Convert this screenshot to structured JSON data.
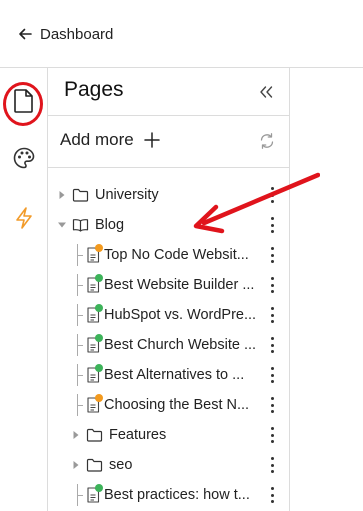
{
  "topbar": {
    "back_label": "Dashboard"
  },
  "panel": {
    "title": "Pages",
    "add_more_label": "Add more"
  },
  "colors": {
    "published": "#3db35a",
    "draft": "#f39a1e",
    "annotation": "#e0141c",
    "accent_icon": "#f29b2a"
  },
  "tree": [
    {
      "type": "folder",
      "label": "University",
      "expanded": false
    },
    {
      "type": "book",
      "label": "Blog",
      "expanded": true
    },
    {
      "type": "page",
      "label": "Top No Code Websit...",
      "status": "draft"
    },
    {
      "type": "page",
      "label": "Best Website Builder ...",
      "status": "published"
    },
    {
      "type": "page",
      "label": "HubSpot vs. WordPre...",
      "status": "published"
    },
    {
      "type": "page",
      "label": "Best Church Website ...",
      "status": "published"
    },
    {
      "type": "page",
      "label": "Best Alternatives to ...",
      "status": "published"
    },
    {
      "type": "page",
      "label": "Choosing the Best N...",
      "status": "draft"
    },
    {
      "type": "subfolder",
      "label": "Features",
      "expanded": false
    },
    {
      "type": "subfolder",
      "label": "seo",
      "expanded": false
    },
    {
      "type": "page",
      "label": "Best practices: how t...",
      "status": "published"
    }
  ]
}
